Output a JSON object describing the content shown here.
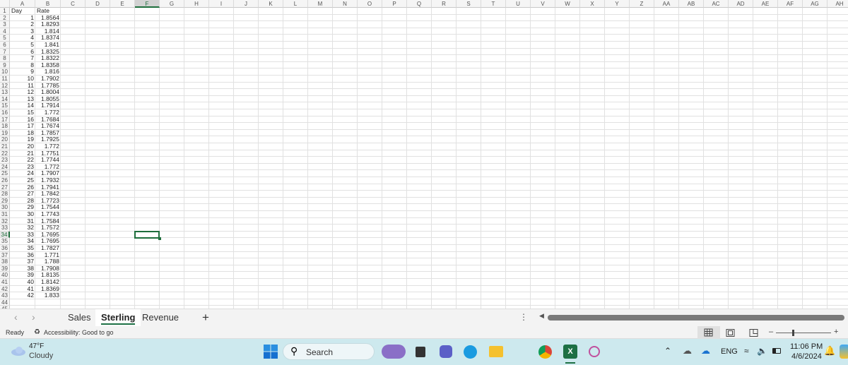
{
  "columns": [
    "A",
    "B",
    "C",
    "D",
    "E",
    "F",
    "G",
    "H",
    "I",
    "J",
    "K",
    "L",
    "M",
    "N",
    "O",
    "P",
    "Q",
    "R",
    "S",
    "T",
    "U",
    "V",
    "W",
    "X",
    "Y",
    "Z",
    "AA",
    "AB",
    "AC",
    "AD",
    "AE",
    "AF",
    "AG",
    "AH"
  ],
  "row_count": 44,
  "selected_cell": "F34",
  "headers": [
    "Day",
    "Rate"
  ],
  "rows": [
    [
      1,
      "1.8564"
    ],
    [
      2,
      "1.8293"
    ],
    [
      3,
      "1.814"
    ],
    [
      4,
      "1.8374"
    ],
    [
      5,
      "1.841"
    ],
    [
      6,
      "1.8325"
    ],
    [
      7,
      "1.8322"
    ],
    [
      8,
      "1.8358"
    ],
    [
      9,
      "1.816"
    ],
    [
      10,
      "1.7902"
    ],
    [
      11,
      "1.7785"
    ],
    [
      12,
      "1.8004"
    ],
    [
      13,
      "1.8055"
    ],
    [
      14,
      "1.7914"
    ],
    [
      15,
      "1.772"
    ],
    [
      16,
      "1.7684"
    ],
    [
      17,
      "1.7674"
    ],
    [
      18,
      "1.7857"
    ],
    [
      19,
      "1.7925"
    ],
    [
      20,
      "1.772"
    ],
    [
      21,
      "1.7751"
    ],
    [
      22,
      "1.7744"
    ],
    [
      23,
      "1.772"
    ],
    [
      24,
      "1.7907"
    ],
    [
      25,
      "1.7932"
    ],
    [
      26,
      "1.7941"
    ],
    [
      27,
      "1.7842"
    ],
    [
      28,
      "1.7723"
    ],
    [
      29,
      "1.7544"
    ],
    [
      30,
      "1.7743"
    ],
    [
      31,
      "1.7584"
    ],
    [
      32,
      "1.7572"
    ],
    [
      33,
      "1.7695"
    ],
    [
      34,
      "1.7695"
    ],
    [
      35,
      "1.7827"
    ],
    [
      36,
      "1.771"
    ],
    [
      37,
      "1.788"
    ],
    [
      38,
      "1.7908"
    ],
    [
      39,
      "1.8135"
    ],
    [
      40,
      "1.8142"
    ],
    [
      41,
      "1.8369"
    ],
    [
      42,
      "1.833"
    ]
  ],
  "sheet_tabs": {
    "tab1": "Sales",
    "tab2": "Sterling",
    "tab3": "Revenue",
    "add": "+"
  },
  "active_tab": "Sterling",
  "status": {
    "ready": "Ready",
    "accessibility": "Accessibility: Good to go"
  },
  "taskbar": {
    "temp": "47°F",
    "weather": "Cloudy",
    "search": "Search",
    "lang": "ENG",
    "time": "11:06 PM",
    "date": "4/6/2024"
  },
  "colors": {
    "accent": "#1e6e3c",
    "taskbar": "#cde9ee"
  }
}
